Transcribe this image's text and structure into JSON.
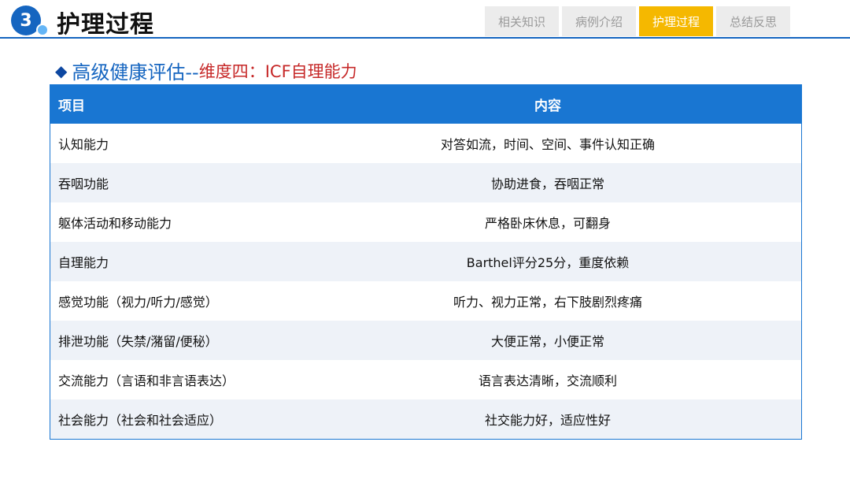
{
  "header": {
    "section_number": "3",
    "section_title": "护理过程",
    "tabs": [
      {
        "label": "相关知识",
        "active": false
      },
      {
        "label": "病例介绍",
        "active": false
      },
      {
        "label": "护理过程",
        "active": true
      },
      {
        "label": "总结反思",
        "active": false
      }
    ]
  },
  "subtitle": {
    "part_a": "高级健康评估--",
    "part_b": "维度四：ICF自理能力"
  },
  "table": {
    "headers": [
      "项目",
      "内容"
    ],
    "rows": [
      [
        "认知能力",
        "对答如流，时间、空间、事件认知正确"
      ],
      [
        "吞咽功能",
        "协助进食，吞咽正常"
      ],
      [
        "躯体活动和移动能力",
        "严格卧床休息，可翻身"
      ],
      [
        "自理能力",
        "Barthel评分25分，重度依赖"
      ],
      [
        "感觉功能（视力/听力/感觉）",
        "听力、视力正常，右下肢剧烈疼痛"
      ],
      [
        "排泄功能（失禁/潴留/便秘）",
        "大便正常，小便正常"
      ],
      [
        "交流能力（言语和非言语表达）",
        "语言表达清晰，交流顺利"
      ],
      [
        "社会能力（社会和社会适应）",
        "社交能力好，适应性好"
      ]
    ]
  },
  "colors": {
    "primary": "#1976d2",
    "active_tab": "#f5b800",
    "accent_red": "#c62828"
  }
}
